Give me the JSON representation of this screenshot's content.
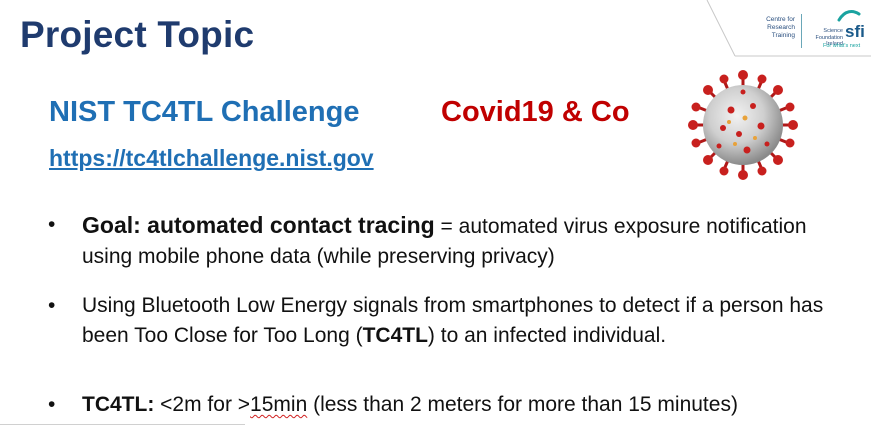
{
  "slide": {
    "title": "Project Topic",
    "challenge_title": "NIST TC4TL Challenge",
    "covid_heading": "Covid19 & Co",
    "challenge_link": "https://tc4tlchallenge.nist.gov"
  },
  "logo": {
    "crt_line1": "Centre for",
    "crt_line2": "Research",
    "crt_line3": "Training",
    "sfi_sub_line1": "Science",
    "sfi_sub_line2": "Foundation",
    "sfi_sub_line3": "Ireland",
    "sfi_mark": "sfi",
    "sfi_tagline": "For what's next"
  },
  "bullets": [
    {
      "strong": "Goal: automated contact tracing",
      "rest": " = automated virus exposure notification using mobile phone data (while preserving privacy)"
    },
    {
      "before": "Using Bluetooth Low Energy signals from smartphones to detect if a person has been Too Close for Too Long (",
      "strong": "TC4TL",
      "after": ") to an infected individual."
    },
    {
      "strong": "TC4TL:",
      "part1": " <2m for >",
      "squiggle": "15min",
      "part2": " (less than 2 meters for more than 15 minutes)"
    }
  ],
  "colors": {
    "title": "#1f3b6e",
    "challenge": "#1f6fb4",
    "covid": "#c00000",
    "text": "#111111"
  },
  "icons": {
    "virus": "coronavirus-illustration",
    "bullet": "bullet-dot"
  }
}
